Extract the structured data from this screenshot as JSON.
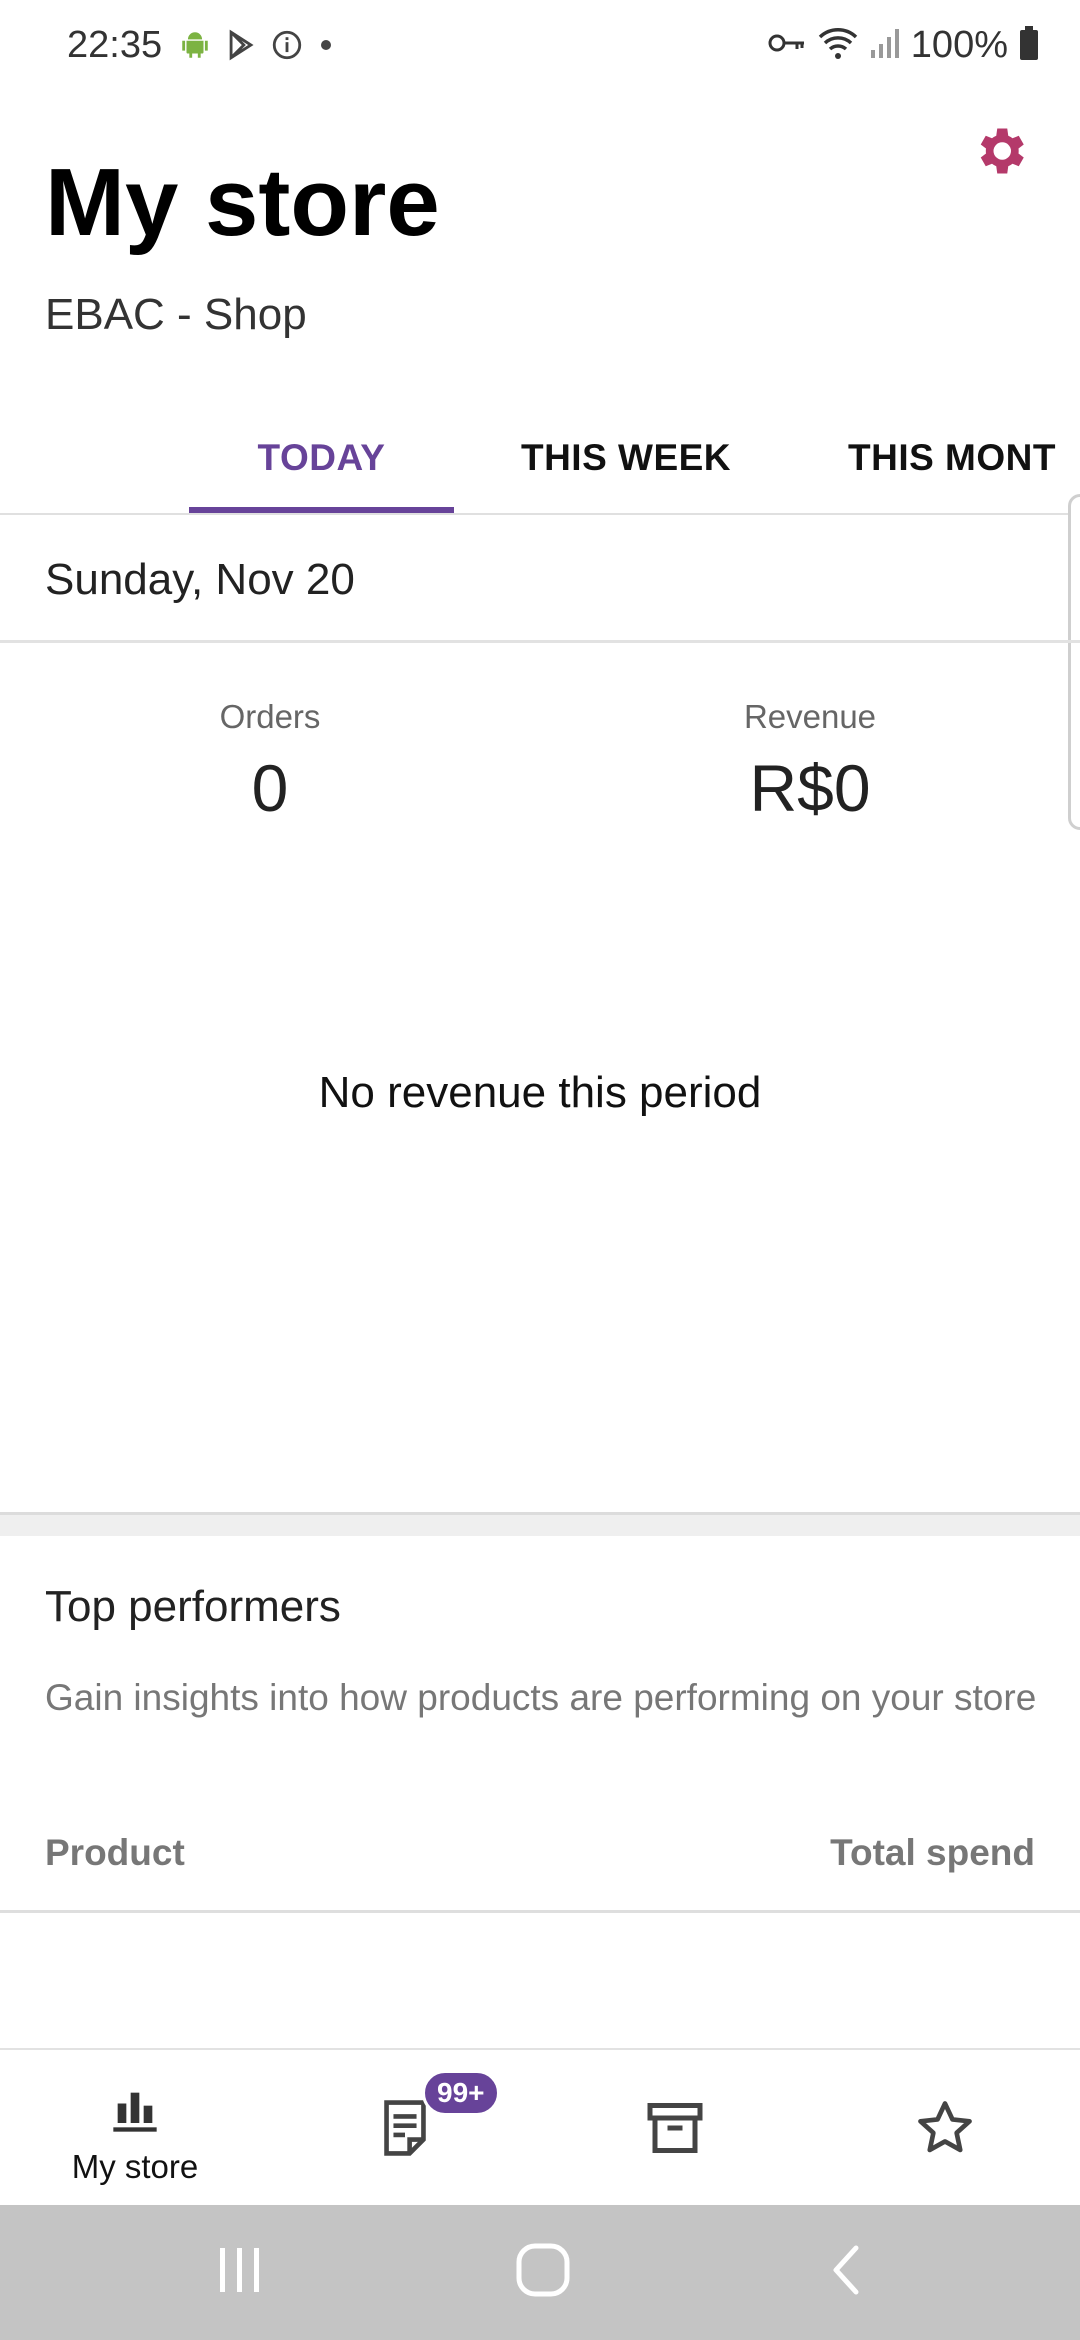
{
  "status_bar": {
    "time": "22:35",
    "battery": "100%",
    "icons": [
      "android-icon",
      "play-store-icon",
      "info-icon",
      "dot-icon",
      "vpn-key-icon",
      "wifi-icon",
      "signal-icon",
      "battery-icon"
    ]
  },
  "header": {
    "title": "My store",
    "store_name": "EBAC - Shop",
    "settings_icon": "gear-icon"
  },
  "tabs": [
    {
      "label": "TODAY",
      "active": true
    },
    {
      "label": "THIS WEEK",
      "active": false
    },
    {
      "label": "THIS MONT",
      "active": false
    }
  ],
  "stats": {
    "date": "Sunday, Nov 20",
    "orders_label": "Orders",
    "orders_value": "0",
    "revenue_label": "Revenue",
    "revenue_value": "R$0",
    "empty_message": "No revenue this period"
  },
  "top_performers": {
    "title": "Top performers",
    "description": "Gain insights into how products are performing on your store",
    "col_product": "Product",
    "col_total": "Total spend"
  },
  "bottom_nav": {
    "items": [
      {
        "label": "My store",
        "icon": "bar-chart-icon",
        "active": true
      },
      {
        "label": "",
        "icon": "orders-icon",
        "badge": "99+"
      },
      {
        "label": "",
        "icon": "archive-icon"
      },
      {
        "label": "",
        "icon": "star-icon"
      }
    ]
  },
  "colors": {
    "accent": "#674399",
    "settings": "#b4396a",
    "system_nav": "#c4c4c4"
  }
}
